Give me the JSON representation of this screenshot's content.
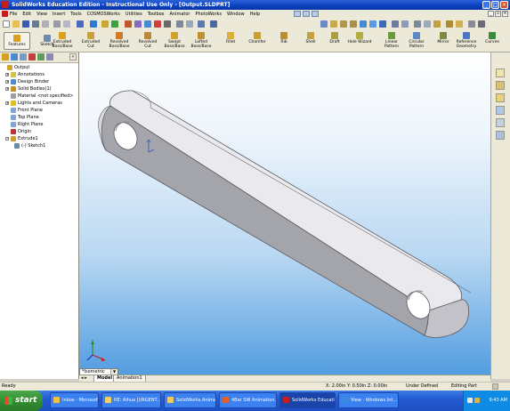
{
  "window": {
    "title": "SolidWorks Education Edition - Instructional Use Only - [Output.SLDPRT]"
  },
  "menu": {
    "items": [
      "File",
      "Edit",
      "View",
      "Insert",
      "Tools",
      "COSMOSWorks",
      "Utilities",
      "Toolbox",
      "Animator",
      "PhotoWorks",
      "Window",
      "Help"
    ]
  },
  "command_manager": {
    "features_label": "Features",
    "sketch_label": "Sketch",
    "tools": [
      {
        "label1": "Extruded",
        "label2": "Boss/Base",
        "icon": "extruded-boss-icon",
        "color": "#d9a020"
      },
      {
        "label1": "Extruded",
        "label2": "Cut",
        "icon": "extruded-cut-icon",
        "color": "#c8a040"
      },
      {
        "label1": "Revolved",
        "label2": "Boss/Base",
        "icon": "revolved-boss-icon",
        "color": "#d07a2a"
      },
      {
        "label1": "Revolved",
        "label2": "Cut",
        "icon": "revolved-cut-icon",
        "color": "#b88a3a"
      },
      {
        "label1": "Swept",
        "label2": "Boss/Base",
        "icon": "swept-boss-icon",
        "color": "#d0a030"
      },
      {
        "label1": "Lofted",
        "label2": "Boss/Base",
        "icon": "lofted-boss-icon",
        "color": "#c09030"
      },
      {
        "label1": "Fillet",
        "label2": "",
        "icon": "fillet-icon",
        "color": "#d8b040"
      },
      {
        "label1": "Chamfer",
        "label2": "",
        "icon": "chamfer-icon",
        "color": "#c8a030"
      },
      {
        "label1": "Rib",
        "label2": "",
        "icon": "rib-icon",
        "color": "#b89030"
      },
      {
        "label1": "Shell",
        "label2": "",
        "icon": "shell-icon",
        "color": "#c0a040"
      },
      {
        "label1": "Draft",
        "label2": "",
        "icon": "draft-icon",
        "color": "#a8a040"
      },
      {
        "label1": "Hole Wizard",
        "label2": "",
        "icon": "hole-wizard-icon",
        "color": "#b0b040"
      },
      {
        "label1": "Linear",
        "label2": "Pattern",
        "icon": "linear-pattern-icon",
        "color": "#6a9a3a"
      },
      {
        "label1": "Circular",
        "label2": "Pattern",
        "icon": "circular-pattern-icon",
        "color": "#5a8ac0"
      },
      {
        "label1": "Mirror",
        "label2": "",
        "icon": "mirror-icon",
        "color": "#7a8a40"
      },
      {
        "label1": "Reference",
        "label2": "Geometry",
        "icon": "reference-geometry-icon",
        "color": "#4a78c0"
      },
      {
        "label1": "Curves",
        "label2": "",
        "icon": "curves-icon",
        "color": "#3a8a3a"
      }
    ]
  },
  "feature_tree": [
    {
      "label": "Output",
      "indent": 0,
      "expander": "",
      "icon": "part-icon",
      "color": "#d0a030"
    },
    {
      "label": "Annotations",
      "indent": 1,
      "expander": "+",
      "icon": "annotations-icon",
      "color": "#d8c040"
    },
    {
      "label": "Design Binder",
      "indent": 1,
      "expander": "+",
      "icon": "design-binder-icon",
      "color": "#4a8ad0"
    },
    {
      "label": "Solid Bodies(1)",
      "indent": 1,
      "expander": "+",
      "icon": "solid-bodies-icon",
      "color": "#c89020"
    },
    {
      "label": "Material <not specified>",
      "indent": 1,
      "expander": "",
      "icon": "material-icon",
      "color": "#9aa0a8"
    },
    {
      "label": "Lights and Cameras",
      "indent": 1,
      "expander": "+",
      "icon": "lights-icon",
      "color": "#e0c020"
    },
    {
      "label": "Front Plane",
      "indent": 1,
      "expander": "",
      "icon": "plane-icon",
      "color": "#7fa6d8"
    },
    {
      "label": "Top Plane",
      "indent": 1,
      "expander": "",
      "icon": "plane-icon",
      "color": "#7fa6d8"
    },
    {
      "label": "Right Plane",
      "indent": 1,
      "expander": "",
      "icon": "plane-icon",
      "color": "#7fa6d8"
    },
    {
      "label": "Origin",
      "indent": 1,
      "expander": "",
      "icon": "origin-icon",
      "color": "#c03030"
    },
    {
      "label": "Extrude1",
      "indent": 1,
      "expander": "-",
      "icon": "extrude-feature-icon",
      "color": "#d0a030"
    },
    {
      "label": "(-) Sketch1",
      "indent": 2,
      "expander": "",
      "icon": "sketch-icon",
      "color": "#6a8ab0"
    }
  ],
  "view": {
    "orientation": "*Isometric"
  },
  "doc_tabs": [
    "Model",
    "Animation1"
  ],
  "status": {
    "left": "Ready",
    "coords": "X: 2.00in  Y: 0.50in  Z: 0.00in",
    "state": "Under Defined",
    "mode": "Editing Part"
  },
  "taskbar": {
    "start_label": "start",
    "tasks": [
      {
        "label": "Inbox - Microsoft O...",
        "icon": "outlook-icon",
        "color": "#f0c040",
        "active": false
      },
      {
        "label": "RE: Alhua [URGENT...",
        "icon": "mail-icon",
        "color": "#f0d060",
        "active": false
      },
      {
        "label": "SolidWorks Animation",
        "icon": "folder-icon",
        "color": "#f0c860",
        "active": false
      },
      {
        "label": "4Bar SW Animation....",
        "icon": "powerpoint-icon",
        "color": "#e06030",
        "active": false
      },
      {
        "label": "SolidWorks Educatio...",
        "icon": "solidworks-icon",
        "color": "#c41e1e",
        "active": true
      },
      {
        "label": "View - Windows Int...",
        "icon": "ie-icon",
        "color": "#3a8ae0",
        "active": false
      }
    ],
    "clock": "9:43 AM"
  },
  "colors": {
    "part_top": "#ececf0",
    "part_side": "#9a9aa0",
    "part_end": "#bdbdc2",
    "background_bottom": "#4f9be0"
  }
}
